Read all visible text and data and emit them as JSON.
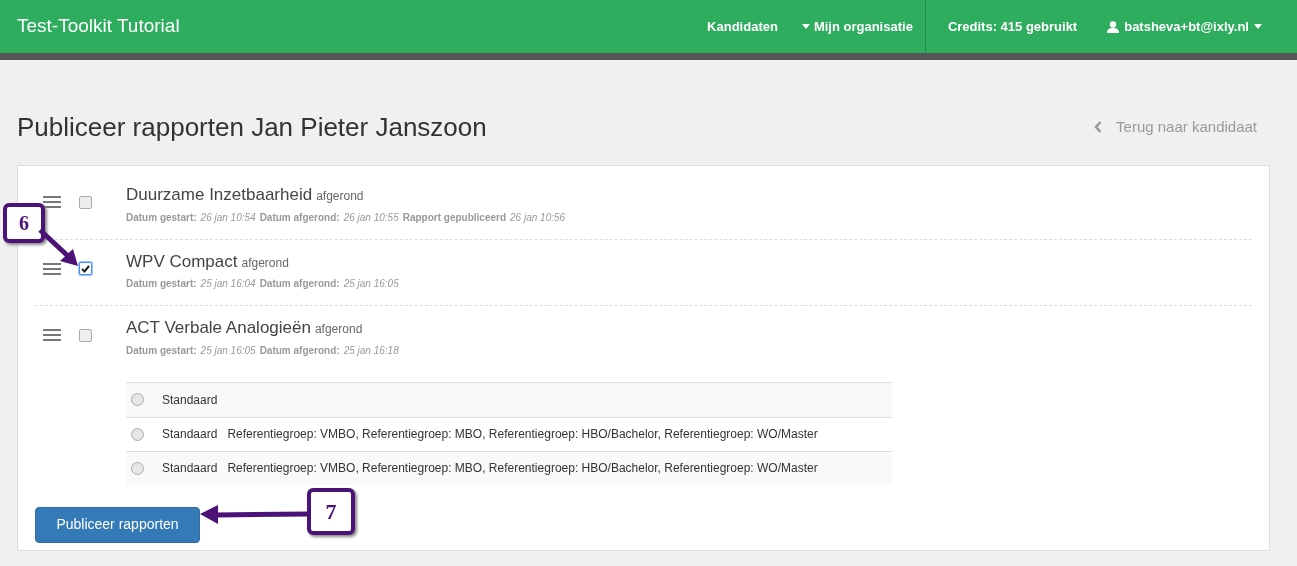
{
  "navbar": {
    "brand": "Test-Toolkit Tutorial",
    "links": [
      {
        "label": "Kandidaten",
        "caret": false
      },
      {
        "label": "Mijn organisatie",
        "caret": true
      }
    ],
    "credits": "Credits: 415 gebruikt",
    "user": "batsheva+bt@ixly.nl"
  },
  "page": {
    "title": "Publiceer rapporten Jan Pieter Janszoon",
    "back_link": "Terug naar kandidaat"
  },
  "reports": [
    {
      "name": "Duurzame Inzetbaarheid",
      "status": "afgerond",
      "checked": false,
      "meta": [
        {
          "label": "Datum gestart:",
          "value": "26 jan 10:54"
        },
        {
          "label": "Datum afgerond:",
          "value": "26 jan 10:55"
        },
        {
          "label": "Rapport gepubliceerd",
          "value": "26 jan 10:56"
        }
      ]
    },
    {
      "name": "WPV Compact",
      "status": "afgerond",
      "checked": true,
      "meta": [
        {
          "label": "Datum gestart:",
          "value": "25 jan 16:04"
        },
        {
          "label": "Datum afgerond:",
          "value": "25 jan 16:05"
        }
      ]
    },
    {
      "name": "ACT Verbale Analogieën",
      "status": "afgerond",
      "checked": false,
      "meta": [
        {
          "label": "Datum gestart:",
          "value": "25 jan 16:05"
        },
        {
          "label": "Datum afgerond:",
          "value": "25 jan 16:18"
        }
      ],
      "options": [
        {
          "norm": "Standaard",
          "selected": false
        },
        {
          "norm": "Standaard",
          "groups": "Referentiegroep: VMBO, Referentiegroep: MBO, Referentiegroep: HBO/Bachelor, Referentiegroep: WO/Master",
          "selected": false
        },
        {
          "norm": "Standaard",
          "groups": "Referentiegroep: VMBO, Referentiegroep: MBO, Referentiegroep: HBO/Bachelor, Referentiegroep: WO/Master",
          "selected": false
        }
      ]
    }
  ],
  "publish_button": "Publiceer rapporten",
  "callouts": [
    "6",
    "7"
  ]
}
